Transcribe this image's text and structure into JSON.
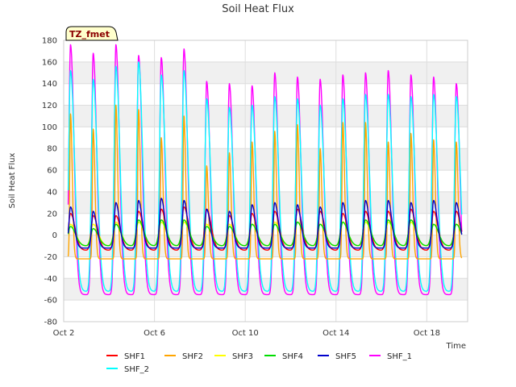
{
  "chart_data": {
    "type": "line",
    "title": "Soil Heat Flux",
    "xlabel": "Time",
    "ylabel": "Soil Heat Flux",
    "tag": "TZ_fmet",
    "xlim": [
      2.0,
      19.8
    ],
    "ylim": [
      -80,
      180
    ],
    "x_ticks": [
      2,
      6,
      10,
      14,
      18
    ],
    "x_tick_labels": [
      "Oct 2",
      "Oct 6",
      "Oct 10",
      "Oct 14",
      "Oct 18"
    ],
    "y_ticks": [
      -80,
      -60,
      -40,
      -20,
      0,
      20,
      40,
      60,
      80,
      100,
      120,
      140,
      160,
      180
    ],
    "grid": true,
    "legend_position": "bottom",
    "colors": {
      "SHF1": "#ff0000",
      "SHF2": "#ffa500",
      "SHF3": "#ffff00",
      "SHF4": "#00dd00",
      "SHF5": "#0000cc",
      "SHF_1": "#ff00ff",
      "SHF_2": "#00ffff",
      "band": "#f0f0f0",
      "gridline": "#dddddd"
    },
    "days": [
      2.3,
      3.3,
      4.3,
      5.3,
      6.3,
      7.3,
      8.3,
      9.3,
      10.3,
      11.3,
      12.3,
      13.3,
      14.3,
      15.3,
      16.3,
      17.3,
      18.3,
      19.3
    ],
    "series": [
      {
        "name": "SHF1",
        "base": -14,
        "peaks": [
          20,
          18,
          18,
          22,
          24,
          26,
          24,
          18,
          20,
          22,
          24,
          22,
          20,
          22,
          22,
          24,
          22,
          22
        ]
      },
      {
        "name": "SHF2",
        "base": -22,
        "peaks": [
          112,
          98,
          120,
          116,
          90,
          110,
          64,
          76,
          86,
          96,
          102,
          80,
          104,
          104,
          86,
          94,
          88,
          86
        ]
      },
      {
        "name": "SHF3",
        "base": -10,
        "peaks": [
          10,
          10,
          12,
          12,
          12,
          12,
          10,
          10,
          10,
          12,
          12,
          10,
          12,
          12,
          12,
          12,
          10,
          10
        ]
      },
      {
        "name": "SHF4",
        "base": -10,
        "peaks": [
          8,
          6,
          10,
          14,
          14,
          14,
          8,
          8,
          10,
          10,
          12,
          10,
          12,
          14,
          14,
          14,
          10,
          10
        ]
      },
      {
        "name": "SHF5",
        "base": -12,
        "peaks": [
          26,
          22,
          30,
          32,
          34,
          32,
          24,
          22,
          28,
          30,
          28,
          26,
          30,
          32,
          32,
          30,
          32,
          30
        ]
      },
      {
        "name": "SHF_1",
        "base": -55,
        "peaks": [
          176,
          168,
          176,
          166,
          164,
          172,
          142,
          140,
          138,
          150,
          146,
          144,
          148,
          150,
          152,
          148,
          146,
          140
        ]
      },
      {
        "name": "SHF_2",
        "base": -52,
        "peaks": [
          152,
          144,
          156,
          160,
          148,
          152,
          126,
          118,
          120,
          128,
          126,
          120,
          126,
          130,
          130,
          128,
          130,
          128
        ]
      }
    ],
    "legend": [
      "SHF1",
      "SHF2",
      "SHF3",
      "SHF4",
      "SHF5",
      "SHF_1",
      "SHF_2"
    ]
  }
}
